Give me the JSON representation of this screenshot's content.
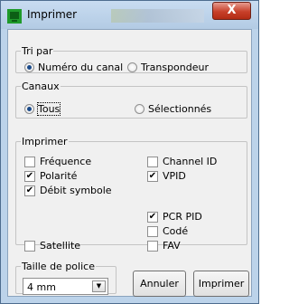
{
  "window": {
    "title": "Imprimer",
    "close_label": "X"
  },
  "tri_par": {
    "legend": "Tri par",
    "options": [
      {
        "label": "Numéro du canal",
        "selected": true
      },
      {
        "label": "Transpondeur",
        "selected": false
      }
    ]
  },
  "canaux": {
    "legend": "Canaux",
    "options": [
      {
        "label": "Tous",
        "selected": true
      },
      {
        "label": "Sélectionnés",
        "selected": false
      }
    ]
  },
  "imprimer": {
    "legend": "Imprimer",
    "checkboxes": [
      {
        "label": "Fréquence",
        "checked": false
      },
      {
        "label": "Polarité",
        "checked": true
      },
      {
        "label": "Débit symbole",
        "checked": true
      },
      {
        "label": "Satellite",
        "checked": false
      },
      {
        "label": "Channel ID",
        "checked": false
      },
      {
        "label": "VPID",
        "checked": true
      },
      {
        "label": "PCR PID",
        "checked": true
      },
      {
        "label": "Codé",
        "checked": false
      },
      {
        "label": "FAV",
        "checked": false
      }
    ]
  },
  "taille_police": {
    "legend": "Taille de police",
    "value": "4 mm"
  },
  "buttons": {
    "cancel": "Annuler",
    "print": "Imprimer"
  },
  "icons": {
    "app": "tv-icon",
    "close": "close-icon",
    "dropdown": "chevron-down-icon"
  }
}
